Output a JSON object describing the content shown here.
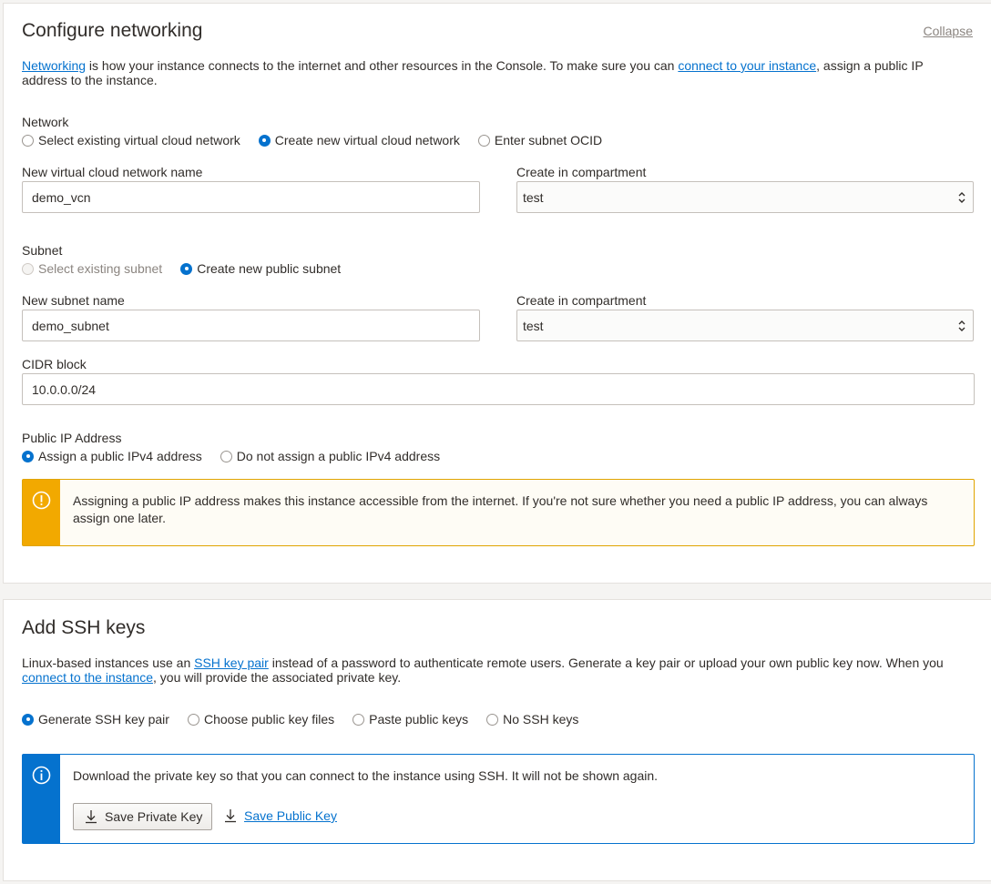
{
  "networking": {
    "title": "Configure networking",
    "collapse_label": "Collapse",
    "intro": {
      "link1": "Networking",
      "text1": " is how your instance connects to the internet and other resources in the Console. To make sure you can ",
      "link2": "connect to your instance",
      "text2": ", assign a public IP address to the instance."
    },
    "network": {
      "label": "Network",
      "options": [
        "Select existing virtual cloud network",
        "Create new virtual cloud network",
        "Enter subnet OCID"
      ],
      "selected": 1
    },
    "vcn_name": {
      "label": "New virtual cloud network name",
      "value": "demo_vcn"
    },
    "vcn_compartment": {
      "label": "Create in compartment",
      "value": "test"
    },
    "subnet": {
      "label": "Subnet",
      "options": [
        "Select existing subnet",
        "Create new public subnet"
      ],
      "selected": 1
    },
    "subnet_name": {
      "label": "New subnet name",
      "value": "demo_subnet"
    },
    "subnet_compartment": {
      "label": "Create in compartment",
      "value": "test"
    },
    "cidr": {
      "label": "CIDR block",
      "value": "10.0.0.0/24"
    },
    "public_ip": {
      "label": "Public IP Address",
      "options": [
        "Assign a public IPv4 address",
        "Do not assign a public IPv4 address"
      ],
      "selected": 0
    },
    "warning": {
      "icon": "exclamation-circle-icon",
      "line1": "Assigning a public IP address makes this instance accessible from the internet. If you're not sure whether you need a public IP address, you can always",
      "line2": "assign one later."
    }
  },
  "ssh": {
    "title": "Add SSH keys",
    "intro": {
      "text1": "Linux-based instances use an ",
      "link1": "SSH key pair",
      "text2": " instead of a password to authenticate remote users. Generate a key pair or upload your own public key now. When you ",
      "link2": "connect to the instance",
      "text3": ", you will provide the associated private key."
    },
    "options": [
      "Generate SSH key pair",
      "Choose public key files",
      "Paste public keys",
      "No SSH keys"
    ],
    "selected": 0,
    "info": {
      "icon": "info-circle-icon",
      "text": "Download the private key so that you can connect to the instance using SSH. It will not be shown again.",
      "save_private": "Save Private Key",
      "save_public": "Save Public Key"
    }
  },
  "colors": {
    "accent": "#0572ce",
    "warning": "#f2a900",
    "text": "#312d2a"
  }
}
